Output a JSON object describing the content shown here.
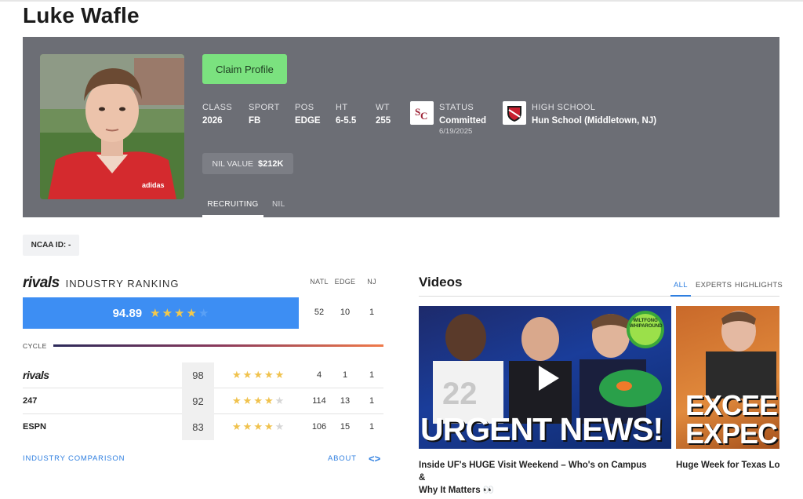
{
  "player": {
    "name": "Luke Wafle"
  },
  "profile": {
    "claim_label": "Claim Profile",
    "stats": [
      {
        "label": "CLASS",
        "value": "2026"
      },
      {
        "label": "SPORT",
        "value": "FB"
      },
      {
        "label": "POS",
        "value": "EDGE"
      },
      {
        "label": "HT",
        "value": "6-5.5"
      },
      {
        "label": "WT",
        "value": "255"
      }
    ],
    "status": {
      "label": "STATUS",
      "value": "Committed",
      "date": "6/19/2025"
    },
    "high_school": {
      "label": "HIGH SCHOOL",
      "value": "Hun School (Middletown, NJ)"
    },
    "nil": {
      "label": "NIL VALUE",
      "value": "$212K"
    },
    "tabs": [
      "RECRUITING",
      "NIL"
    ]
  },
  "ncaa": {
    "label": "NCAA ID:",
    "value": "-"
  },
  "ranking": {
    "brand": "rivals",
    "title": "INDUSTRY RANKING",
    "columns": [
      "NATL",
      "EDGE",
      "NJ"
    ],
    "composite": {
      "score": "94.89",
      "stars": 4,
      "natl": "52",
      "pos": "10",
      "state": "1"
    },
    "cycle_label": "CYCLE",
    "services": [
      {
        "name": "rivals",
        "score": "98",
        "stars": 5,
        "natl": "4",
        "pos": "1",
        "state": "1"
      },
      {
        "name": "247",
        "score": "92",
        "stars": 4,
        "natl": "114",
        "pos": "13",
        "state": "1"
      },
      {
        "name": "ESPN",
        "score": "83",
        "stars": 4,
        "natl": "106",
        "pos": "15",
        "state": "1"
      }
    ],
    "comparison_link": "INDUSTRY COMPARISON",
    "about_link": "ABOUT"
  },
  "videos": {
    "title": "Videos",
    "tabs": [
      "ALL",
      "EXPERTS",
      "HIGHLIGHTS"
    ],
    "items": [
      {
        "title_line1": "Inside UF's HUGE Visit Weekend – Who's on Campus &",
        "title_line2": "Why It Matters 👀",
        "thumb_text": "URGENT NEWS!",
        "badge": "WILTFONG WHIPAROUND"
      },
      {
        "title_line1": "Huge Week for Texas Lor",
        "thumb_text_1": "EXCEE",
        "thumb_text_2": "EXPEC"
      }
    ]
  },
  "colors": {
    "hero_bg": "#6c6e75",
    "claim_green": "#7be27f",
    "score_blue": "#3d8ef3",
    "link_blue": "#2f7fe0",
    "star_gold": "#f2c94c"
  }
}
